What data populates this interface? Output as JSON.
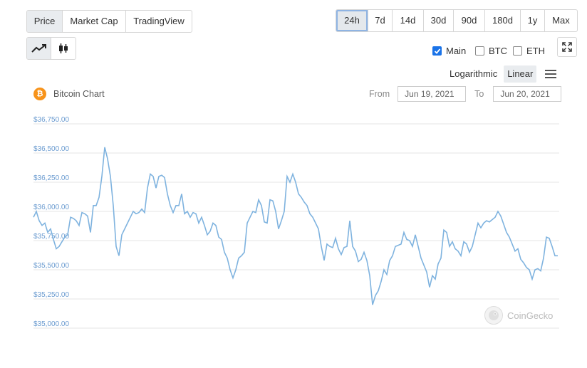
{
  "view_tabs": [
    {
      "label": "Price",
      "active": true
    },
    {
      "label": "Market Cap",
      "active": false
    },
    {
      "label": "TradingView",
      "active": false
    }
  ],
  "range_tabs": [
    {
      "label": "24h",
      "active": true
    },
    {
      "label": "7d",
      "active": false
    },
    {
      "label": "14d",
      "active": false
    },
    {
      "label": "30d",
      "active": false
    },
    {
      "label": "90d",
      "active": false
    },
    {
      "label": "180d",
      "active": false
    },
    {
      "label": "1y",
      "active": false
    },
    {
      "label": "Max",
      "active": false
    }
  ],
  "chart_type": {
    "selected": "line",
    "icons": [
      "line-chart-icon",
      "candlestick-icon"
    ]
  },
  "compare": [
    {
      "label": "Main",
      "checked": true
    },
    {
      "label": "BTC",
      "checked": false
    },
    {
      "label": "ETH",
      "checked": false
    }
  ],
  "scale": {
    "options": [
      "Logarithmic",
      "Linear"
    ],
    "selected": "Linear"
  },
  "chart_title": "Bitcoin Chart",
  "date_range": {
    "from_label": "From",
    "from": "Jun 19, 2021",
    "to_label": "To",
    "to": "Jun 20, 2021"
  },
  "watermark": "CoinGecko",
  "colors": {
    "line": "#7fb3df",
    "tick": "#6a9bd0",
    "btc": "#f7931a",
    "active_outline": "#8fb4e3"
  },
  "chart_data": {
    "type": "line",
    "title": "Bitcoin Chart",
    "xlabel": "",
    "ylabel": "",
    "ylim": [
      35000,
      36750
    ],
    "yticks": [
      "$36,750.00",
      "$36,500.00",
      "$36,250.00",
      "$36,000.00",
      "$35,750.00",
      "$35,500.00",
      "$35,250.00",
      "$35,000.00"
    ],
    "ytick_values": [
      36750,
      36500,
      36250,
      36000,
      35750,
      35500,
      35250,
      35000
    ],
    "grid": true,
    "series": [
      {
        "values": [
          35950,
          36000,
          35920,
          35880,
          35900,
          35820,
          35850,
          35760,
          35680,
          35700,
          35740,
          35780,
          35800,
          35950,
          35940,
          35920,
          35880,
          35990,
          35980,
          35960,
          35820,
          36050,
          36050,
          36120,
          36300,
          36550,
          36450,
          36300,
          36050,
          35700,
          35620,
          35800,
          35850,
          35900,
          35950,
          36000,
          35980,
          35990,
          36020,
          35990,
          36200,
          36320,
          36300,
          36200,
          36300,
          36310,
          36290,
          36150,
          36050,
          35990,
          36050,
          36050,
          36150,
          35980,
          36000,
          35950,
          35990,
          35980,
          35900,
          35950,
          35880,
          35800,
          35830,
          35900,
          35880,
          35780,
          35760,
          35650,
          35600,
          35500,
          35430,
          35500,
          35600,
          35620,
          35650,
          35900,
          35950,
          36000,
          35990,
          36100,
          36050,
          35910,
          35900,
          36100,
          36090,
          36000,
          35850,
          35920,
          36000,
          36300,
          36250,
          36320,
          36250,
          36150,
          36120,
          36080,
          36050,
          35980,
          35950,
          35900,
          35850,
          35700,
          35580,
          35720,
          35700,
          35690,
          35770,
          35680,
          35630,
          35690,
          35700,
          35920,
          35700,
          35660,
          35570,
          35590,
          35650,
          35580,
          35450,
          35200,
          35280,
          35320,
          35400,
          35500,
          35460,
          35580,
          35620,
          35700,
          35710,
          35720,
          35820,
          35760,
          35750,
          35700,
          35800,
          35700,
          35600,
          35540,
          35480,
          35350,
          35450,
          35420,
          35550,
          35600,
          35840,
          35820,
          35700,
          35740,
          35680,
          35660,
          35620,
          35740,
          35720,
          35650,
          35700,
          35800,
          35900,
          35860,
          35900,
          35920,
          35910,
          35930,
          35950,
          36000,
          35960,
          35890,
          35820,
          35780,
          35720,
          35660,
          35680,
          35590,
          35560,
          35520,
          35500,
          35420,
          35500,
          35510,
          35490,
          35600,
          35780,
          35770,
          35700,
          35620,
          35620
        ]
      }
    ]
  }
}
